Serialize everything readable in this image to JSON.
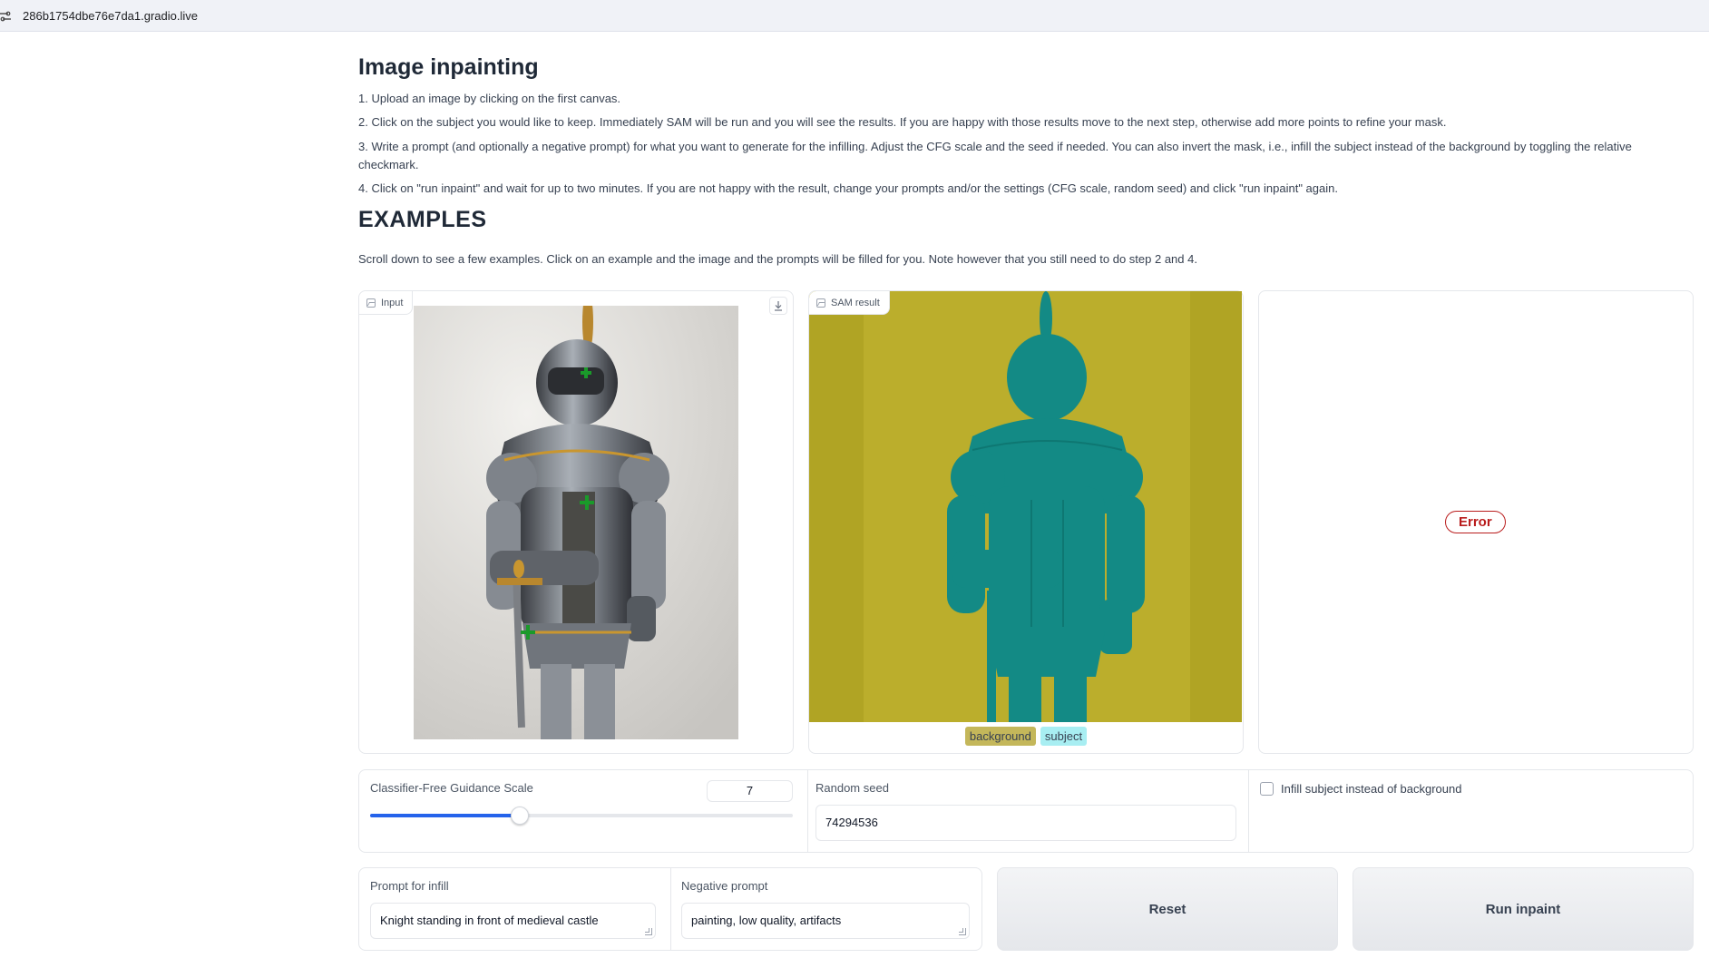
{
  "browser": {
    "url": "286b1754dbe76e7da1.gradio.live"
  },
  "header": {
    "title": "Image inpainting",
    "steps": [
      "1. Upload an image by clicking on the first canvas.",
      "2. Click on the subject you would like to keep. Immediately SAM will be run and you will see the results. If you are happy with those results move to the next step, otherwise add more points to refine your mask.",
      "3. Write a prompt (and optionally a negative prompt) for what you want to generate for the infilling. Adjust the CFG scale and the seed if needed. You can also invert the mask, i.e., infill the subject instead of the background by toggling the relative checkmark.",
      "4. Click on \"run inpaint\" and wait for up to two minutes. If you are not happy with the result, change your prompts and/or the settings (CFG scale, random seed) and click \"run inpaint\" again."
    ],
    "examples_title": "EXAMPLES",
    "examples_note": "Scroll down to see a few examples. Click on an example and the image and the prompts will be filled for you. Note however that you still need to do step 2 and 4."
  },
  "input_panel": {
    "label": "Input",
    "icon": "image-icon",
    "download_icon": "download-icon"
  },
  "sam_panel": {
    "label": "SAM result",
    "legend": [
      {
        "label": "background",
        "color": "#c4b75a"
      },
      {
        "label": "subject",
        "color": "#a8eef2"
      }
    ],
    "mask_colors": {
      "background": "#b9ad2b",
      "subject": "#138a85"
    }
  },
  "output_panel": {
    "error_label": "Error"
  },
  "controls": {
    "cfg_label": "Classifier-Free Guidance Scale",
    "cfg_value": "7",
    "cfg_fraction": 0.355,
    "seed_label": "Random seed",
    "seed_value": "74294536",
    "infill_label": "Infill subject instead of background",
    "infill_checked": false
  },
  "prompts": {
    "prompt_label": "Prompt for infill",
    "prompt_value": "Knight standing in front of medieval castle",
    "negative_label": "Negative prompt",
    "negative_value": "painting, low quality, artifacts"
  },
  "buttons": {
    "reset": "Reset",
    "run": "Run inpaint"
  },
  "accent_color": "#2563eb"
}
